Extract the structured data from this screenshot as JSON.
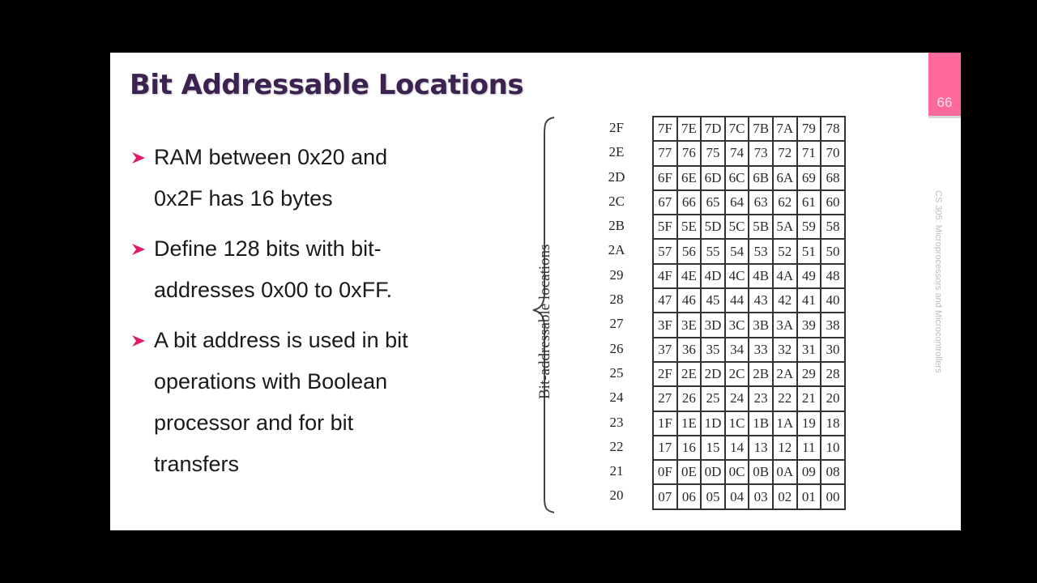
{
  "slide": {
    "title": "Bit Addressable Locations",
    "page_number": "66",
    "sidebar_text": "CS 305: Microprocessors and Microcontrollers",
    "colors": {
      "title": "#3b2250",
      "accent_tab": "#ff6a9a",
      "bullet_arrow": "#e0176a"
    },
    "bullets": [
      {
        "icon": "arrow-bullet-icon",
        "lines": [
          "RAM between 0x20 and",
          "0x2F has 16 bytes"
        ]
      },
      {
        "icon": "arrow-bullet-icon",
        "lines": [
          "Define 128 bits with bit-",
          "addresses 0x00 to 0xFF."
        ]
      },
      {
        "icon": "arrow-bullet-icon",
        "lines": [
          "A bit address is used in bit",
          "operations with Boolean",
          "processor and for bit",
          "transfers"
        ]
      }
    ]
  },
  "diagram": {
    "side_label": "Bit-addressable locations",
    "byte_addresses": [
      "2F",
      "2E",
      "2D",
      "2C",
      "2B",
      "2A",
      "29",
      "28",
      "27",
      "26",
      "25",
      "24",
      "23",
      "22",
      "21",
      "20"
    ],
    "bit_rows": [
      [
        "7F",
        "7E",
        "7D",
        "7C",
        "7B",
        "7A",
        "79",
        "78"
      ],
      [
        "77",
        "76",
        "75",
        "74",
        "73",
        "72",
        "71",
        "70"
      ],
      [
        "6F",
        "6E",
        "6D",
        "6C",
        "6B",
        "6A",
        "69",
        "68"
      ],
      [
        "67",
        "66",
        "65",
        "64",
        "63",
        "62",
        "61",
        "60"
      ],
      [
        "5F",
        "5E",
        "5D",
        "5C",
        "5B",
        "5A",
        "59",
        "58"
      ],
      [
        "57",
        "56",
        "55",
        "54",
        "53",
        "52",
        "51",
        "50"
      ],
      [
        "4F",
        "4E",
        "4D",
        "4C",
        "4B",
        "4A",
        "49",
        "48"
      ],
      [
        "47",
        "46",
        "45",
        "44",
        "43",
        "42",
        "41",
        "40"
      ],
      [
        "3F",
        "3E",
        "3D",
        "3C",
        "3B",
        "3A",
        "39",
        "38"
      ],
      [
        "37",
        "36",
        "35",
        "34",
        "33",
        "32",
        "31",
        "30"
      ],
      [
        "2F",
        "2E",
        "2D",
        "2C",
        "2B",
        "2A",
        "29",
        "28"
      ],
      [
        "27",
        "26",
        "25",
        "24",
        "23",
        "22",
        "21",
        "20"
      ],
      [
        "1F",
        "1E",
        "1D",
        "1C",
        "1B",
        "1A",
        "19",
        "18"
      ],
      [
        "17",
        "16",
        "15",
        "14",
        "13",
        "12",
        "11",
        "10"
      ],
      [
        "0F",
        "0E",
        "0D",
        "0C",
        "0B",
        "0A",
        "09",
        "08"
      ],
      [
        "07",
        "06",
        "05",
        "04",
        "03",
        "02",
        "01",
        "00"
      ]
    ]
  }
}
